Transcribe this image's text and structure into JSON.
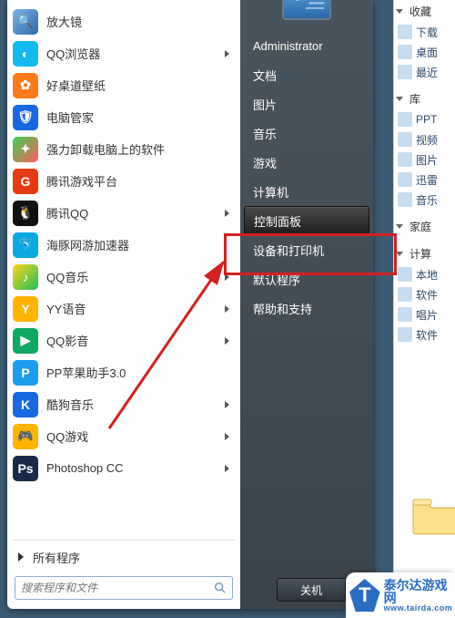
{
  "user": {
    "name": "Administrator"
  },
  "programs": [
    {
      "label": "放大镜",
      "arrow": false,
      "bg": "linear-gradient(135deg,#7fb3e6,#2b6aac)",
      "glyph": "🔍"
    },
    {
      "label": "QQ浏览器",
      "arrow": true,
      "bg": "#14b9ef",
      "glyph": "◐"
    },
    {
      "label": "好桌道壁纸",
      "arrow": false,
      "bg": "#ff7a1a",
      "glyph": "✿"
    },
    {
      "label": "电脑管家",
      "arrow": false,
      "bg": "#1668e3",
      "glyph": "🛡"
    },
    {
      "label": "强力卸载电脑上的软件",
      "arrow": false,
      "bg": "linear-gradient(135deg,#39d353,#ff5a5a)",
      "glyph": "✦"
    },
    {
      "label": "腾讯游戏平台",
      "arrow": false,
      "bg": "#e43b12",
      "glyph": "G"
    },
    {
      "label": "腾讯QQ",
      "arrow": true,
      "bg": "#111",
      "glyph": "🐧"
    },
    {
      "label": "海豚网游加速器",
      "arrow": false,
      "bg": "#0aa9e6",
      "glyph": "🐬"
    },
    {
      "label": "QQ音乐",
      "arrow": true,
      "bg": "linear-gradient(135deg,#ffd21a,#1cc25a)",
      "glyph": "♪"
    },
    {
      "label": "YY语音",
      "arrow": true,
      "bg": "#ffb400",
      "glyph": "Y"
    },
    {
      "label": "QQ影音",
      "arrow": true,
      "bg": "#0ea860",
      "glyph": "▶"
    },
    {
      "label": "PP苹果助手3.0",
      "arrow": false,
      "bg": "#1e9df0",
      "glyph": "P"
    },
    {
      "label": "酷狗音乐",
      "arrow": true,
      "bg": "#1668e3",
      "glyph": "K"
    },
    {
      "label": "QQ游戏",
      "arrow": true,
      "bg": "#ffb400",
      "glyph": "🎮"
    },
    {
      "label": "Photoshop CC",
      "arrow": true,
      "bg": "#1a2a44",
      "glyph": "Ps"
    }
  ],
  "all_programs_label": "所有程序",
  "search_placeholder": "搜索程序和文件",
  "right_items": [
    {
      "label": "文档"
    },
    {
      "label": "图片"
    },
    {
      "label": "音乐"
    },
    {
      "label": "游戏"
    },
    {
      "label": "计算机"
    },
    {
      "label": "控制面板",
      "highlight": true
    },
    {
      "label": "设备和打印机"
    },
    {
      "label": "默认程序"
    },
    {
      "label": "帮助和支持"
    }
  ],
  "shutdown": {
    "label": "关机"
  },
  "explorer": {
    "favorites": {
      "label": "收藏",
      "items": [
        "下载",
        "桌面",
        "最近"
      ]
    },
    "library": {
      "label": "库",
      "items": [
        "PPT",
        "视频",
        "图片",
        "迅雷",
        "音乐"
      ]
    },
    "homegroup": {
      "label": "家庭"
    },
    "computer": {
      "label": "计算",
      "items": [
        "本地",
        "软件",
        "唱片",
        "软件"
      ]
    }
  },
  "watermark": {
    "brand": "泰尔达游戏网",
    "url": "www.tairda.com",
    "badge": "T"
  }
}
